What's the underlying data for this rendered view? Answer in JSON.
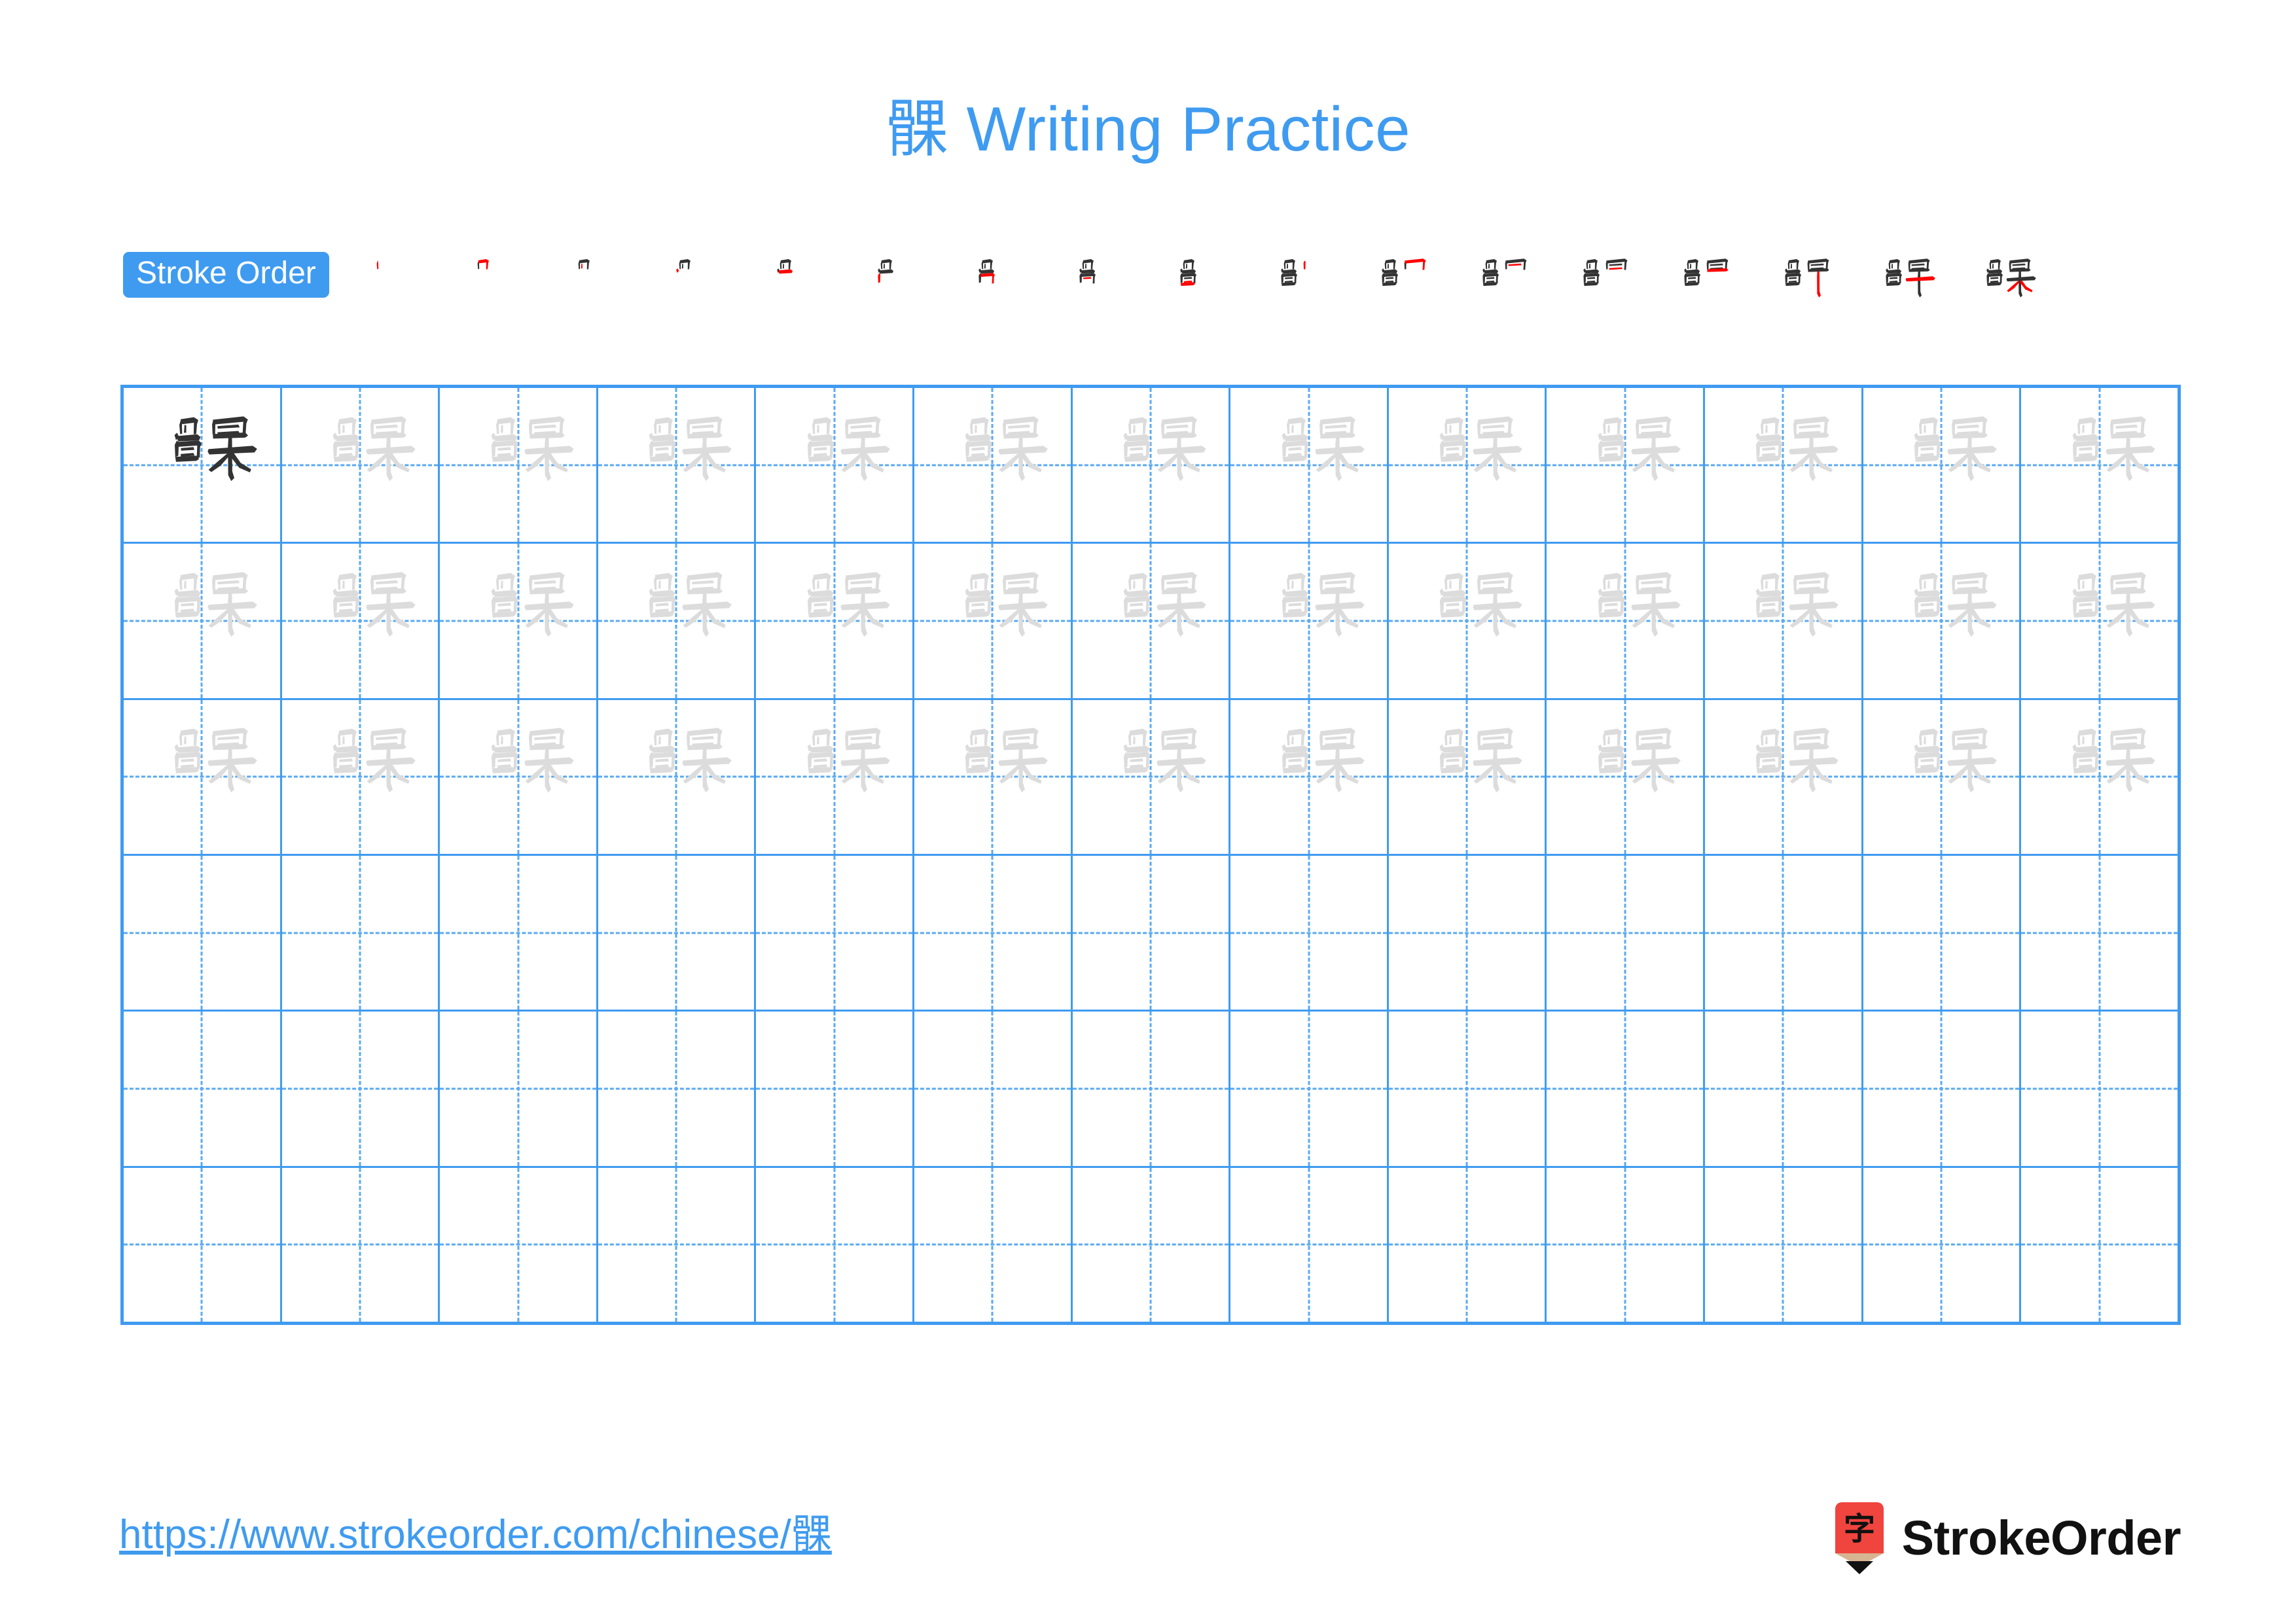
{
  "character": "髁",
  "title": {
    "text": "髁 Writing Practice"
  },
  "colors": {
    "accent_blue": "#3f9bf0",
    "grid_line": "#3f9bf0",
    "grid_dash": "#5aa9f2",
    "glyph_dark": "#333333",
    "glyph_light": "#dcdcdc",
    "stroke_new": "#ff0000",
    "stroke_old": "#333333",
    "logo_red": "#f0443e",
    "logo_tan": "#d7b492",
    "wordmark": "#111111"
  },
  "stroke_order": {
    "label": "Stroke Order",
    "total_strokes": 17,
    "steps": [
      {
        "index": 1,
        "strokes_shown": 1,
        "new_stroke_color": "#ff0000"
      },
      {
        "index": 2,
        "strokes_shown": 2,
        "new_stroke_color": "#ff0000"
      },
      {
        "index": 3,
        "strokes_shown": 3,
        "new_stroke_color": "#ff0000"
      },
      {
        "index": 4,
        "strokes_shown": 4,
        "new_stroke_color": "#ff0000"
      },
      {
        "index": 5,
        "strokes_shown": 5,
        "new_stroke_color": "#ff0000"
      },
      {
        "index": 6,
        "strokes_shown": 6,
        "new_stroke_color": "#ff0000"
      },
      {
        "index": 7,
        "strokes_shown": 7,
        "new_stroke_color": "#ff0000"
      },
      {
        "index": 8,
        "strokes_shown": 8,
        "new_stroke_color": "#ff0000"
      },
      {
        "index": 9,
        "strokes_shown": 9,
        "new_stroke_color": "#ff0000"
      },
      {
        "index": 10,
        "strokes_shown": 10,
        "new_stroke_color": "#ff0000"
      },
      {
        "index": 11,
        "strokes_shown": 11,
        "new_stroke_color": "#ff0000"
      },
      {
        "index": 12,
        "strokes_shown": 12,
        "new_stroke_color": "#ff0000"
      },
      {
        "index": 13,
        "strokes_shown": 13,
        "new_stroke_color": "#ff0000"
      },
      {
        "index": 14,
        "strokes_shown": 14,
        "new_stroke_color": "#ff0000"
      },
      {
        "index": 15,
        "strokes_shown": 15,
        "new_stroke_color": "#ff0000"
      },
      {
        "index": 16,
        "strokes_shown": 16,
        "new_stroke_color": "#ff0000"
      },
      {
        "index": 17,
        "strokes_shown": 17,
        "new_stroke_color": "#ff0000"
      }
    ]
  },
  "practice_grid": {
    "columns": 13,
    "rows": 6,
    "cells": [
      [
        "dark",
        "light",
        "light",
        "light",
        "light",
        "light",
        "light",
        "light",
        "light",
        "light",
        "light",
        "light",
        "light"
      ],
      [
        "light",
        "light",
        "light",
        "light",
        "light",
        "light",
        "light",
        "light",
        "light",
        "light",
        "light",
        "light",
        "light"
      ],
      [
        "light",
        "light",
        "light",
        "light",
        "light",
        "light",
        "light",
        "light",
        "light",
        "light",
        "light",
        "light",
        "light"
      ],
      [
        "empty",
        "empty",
        "empty",
        "empty",
        "empty",
        "empty",
        "empty",
        "empty",
        "empty",
        "empty",
        "empty",
        "empty",
        "empty"
      ],
      [
        "empty",
        "empty",
        "empty",
        "empty",
        "empty",
        "empty",
        "empty",
        "empty",
        "empty",
        "empty",
        "empty",
        "empty",
        "empty"
      ],
      [
        "empty",
        "empty",
        "empty",
        "empty",
        "empty",
        "empty",
        "empty",
        "empty",
        "empty",
        "empty",
        "empty",
        "empty",
        "empty"
      ]
    ]
  },
  "footer": {
    "url": "https://www.strokeorder.com/chinese/髁",
    "logo_character": "字",
    "logo_text": "StrokeOrder"
  }
}
